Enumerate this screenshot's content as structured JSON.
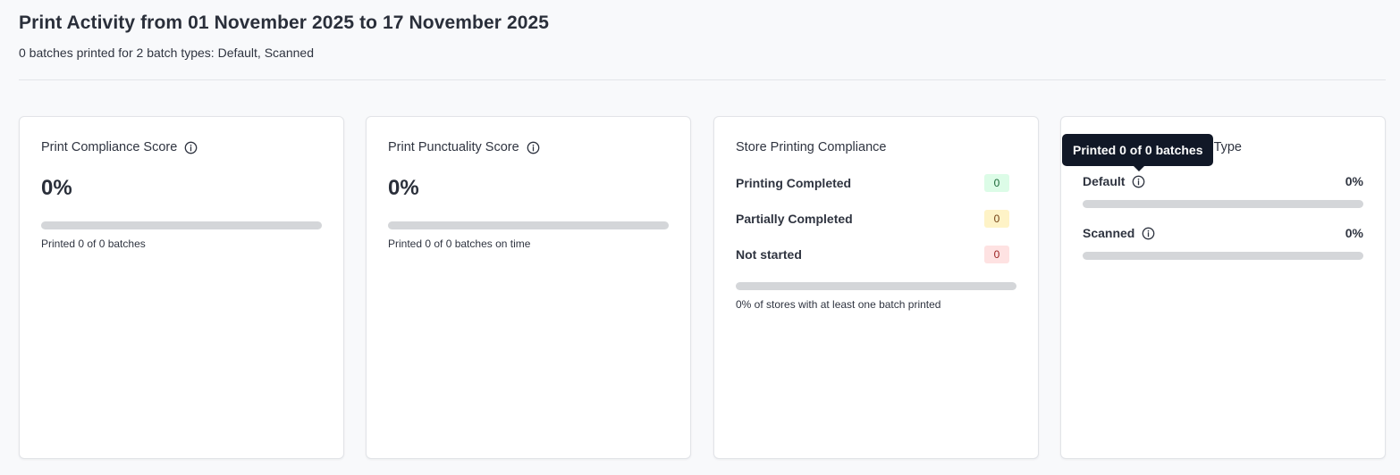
{
  "header": {
    "title": "Print Activity from 01 November 2025 to 17 November 2025",
    "subtitle": "0 batches printed for 2 batch types: Default, Scanned"
  },
  "compliance_card": {
    "title": "Print Compliance Score",
    "score": "0%",
    "progress_fraction": 0,
    "caption": "Printed 0 of 0 batches"
  },
  "punctuality_card": {
    "title": "Print Punctuality Score",
    "score": "0%",
    "progress_fraction": 0,
    "caption": "Printed 0 of 0 batches on time"
  },
  "store_card": {
    "title": "Store Printing Compliance",
    "rows": [
      {
        "label": "Printing Completed",
        "count": "0",
        "color": "#dcfce7"
      },
      {
        "label": "Partially Completed",
        "count": "0",
        "color": "#fef3c7"
      },
      {
        "label": "Not started",
        "count": "0",
        "color": "#fee2e2"
      }
    ],
    "progress_fraction": 0,
    "caption": "0% of stores with at least one batch printed"
  },
  "type_card": {
    "title_visible_fragment": "Type",
    "types": [
      {
        "label": "Default",
        "percent": "0%",
        "progress_fraction": 0
      },
      {
        "label": "Scanned",
        "percent": "0%",
        "progress_fraction": 0
      }
    ]
  },
  "tooltip": {
    "text": "Printed 0 of 0 batches"
  },
  "icons": {
    "info": "info-icon"
  },
  "colors": {
    "progress_track": "#d4d6d9",
    "tooltip_bg": "#111827"
  }
}
